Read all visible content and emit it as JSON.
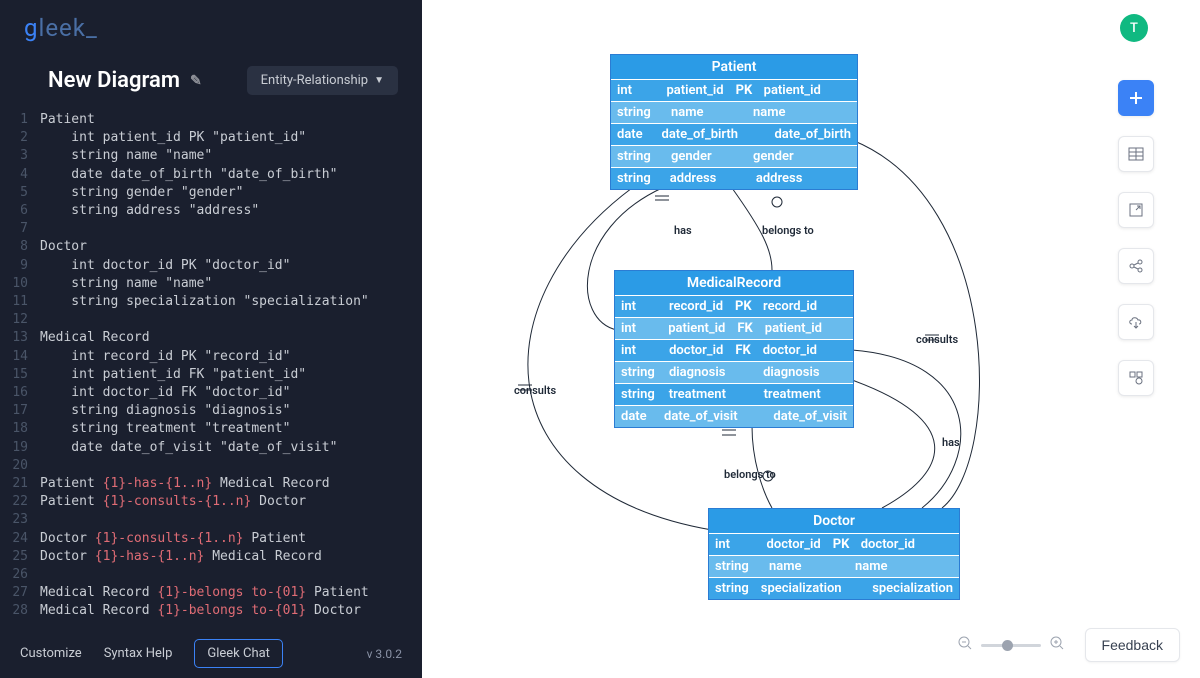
{
  "app_name": "gleek_",
  "diagram_title": "New Diagram",
  "diagram_type": "Entity-Relationship",
  "avatar_initial": "T",
  "version": "v 3.0.2",
  "footer": {
    "customize": "Customize",
    "syntax_help": "Syntax Help",
    "gleek_chat": "Gleek Chat"
  },
  "feedback_label": "Feedback",
  "code_lines": [
    "Patient",
    "    int patient_id PK \"patient_id\"",
    "    string name \"name\"",
    "    date date_of_birth \"date_of_birth\"",
    "    string gender \"gender\"",
    "    string address \"address\"",
    "",
    "Doctor",
    "    int doctor_id PK \"doctor_id\"",
    "    string name \"name\"",
    "    string specialization \"specialization\"",
    "",
    "Medical Record",
    "    int record_id PK \"record_id\"",
    "    int patient_id FK \"patient_id\"",
    "    int doctor_id FK \"doctor_id\"",
    "    string diagnosis \"diagnosis\"",
    "    string treatment \"treatment\"",
    "    date date_of_visit \"date_of_visit\"",
    "",
    "Patient {1}-has-{1..n} Medical Record",
    "Patient {1}-consults-{1..n} Doctor",
    "",
    "Doctor {1}-consults-{1..n} Patient",
    "Doctor {1}-has-{1..n} Medical Record",
    "",
    "Medical Record {1}-belongs to-{01} Patient",
    "Medical Record {1}-belongs to-{01} Doctor"
  ],
  "rel_tokens": {
    "21": "{1}-has-{1..n}",
    "22": "{1}-consults-{1..n}",
    "24": "{1}-consults-{1..n}",
    "25": "{1}-has-{1..n}",
    "27": "{1}-belongs to-{01}",
    "28": "{1}-belongs to-{01}"
  },
  "entities": {
    "patient": {
      "title": "Patient",
      "rows": [
        {
          "type": "int",
          "name": "patient_id",
          "key": "PK",
          "alias": "patient_id"
        },
        {
          "type": "string",
          "name": "name",
          "key": "",
          "alias": "name"
        },
        {
          "type": "date",
          "name": "date_of_birth",
          "key": "",
          "alias": "date_of_birth"
        },
        {
          "type": "string",
          "name": "gender",
          "key": "",
          "alias": "gender"
        },
        {
          "type": "string",
          "name": "address",
          "key": "",
          "alias": "address"
        }
      ]
    },
    "medicalrecord": {
      "title": "MedicalRecord",
      "rows": [
        {
          "type": "int",
          "name": "record_id",
          "key": "PK",
          "alias": "record_id"
        },
        {
          "type": "int",
          "name": "patient_id",
          "key": "FK",
          "alias": "patient_id"
        },
        {
          "type": "int",
          "name": "doctor_id",
          "key": "FK",
          "alias": "doctor_id"
        },
        {
          "type": "string",
          "name": "diagnosis",
          "key": "",
          "alias": "diagnosis"
        },
        {
          "type": "string",
          "name": "treatment",
          "key": "",
          "alias": "treatment"
        },
        {
          "type": "date",
          "name": "date_of_visit",
          "key": "",
          "alias": "date_of_visit"
        }
      ]
    },
    "doctor": {
      "title": "Doctor",
      "rows": [
        {
          "type": "int",
          "name": "doctor_id",
          "key": "PK",
          "alias": "doctor_id"
        },
        {
          "type": "string",
          "name": "name",
          "key": "",
          "alias": "name"
        },
        {
          "type": "string",
          "name": "specialization",
          "key": "",
          "alias": "specialization"
        }
      ]
    }
  },
  "rel_labels": {
    "has_top": "has",
    "belongs_top": "belongs to",
    "consults_left": "consults",
    "consults_right": "consults",
    "has_right": "has",
    "belongs_bottom": "belongs to"
  }
}
